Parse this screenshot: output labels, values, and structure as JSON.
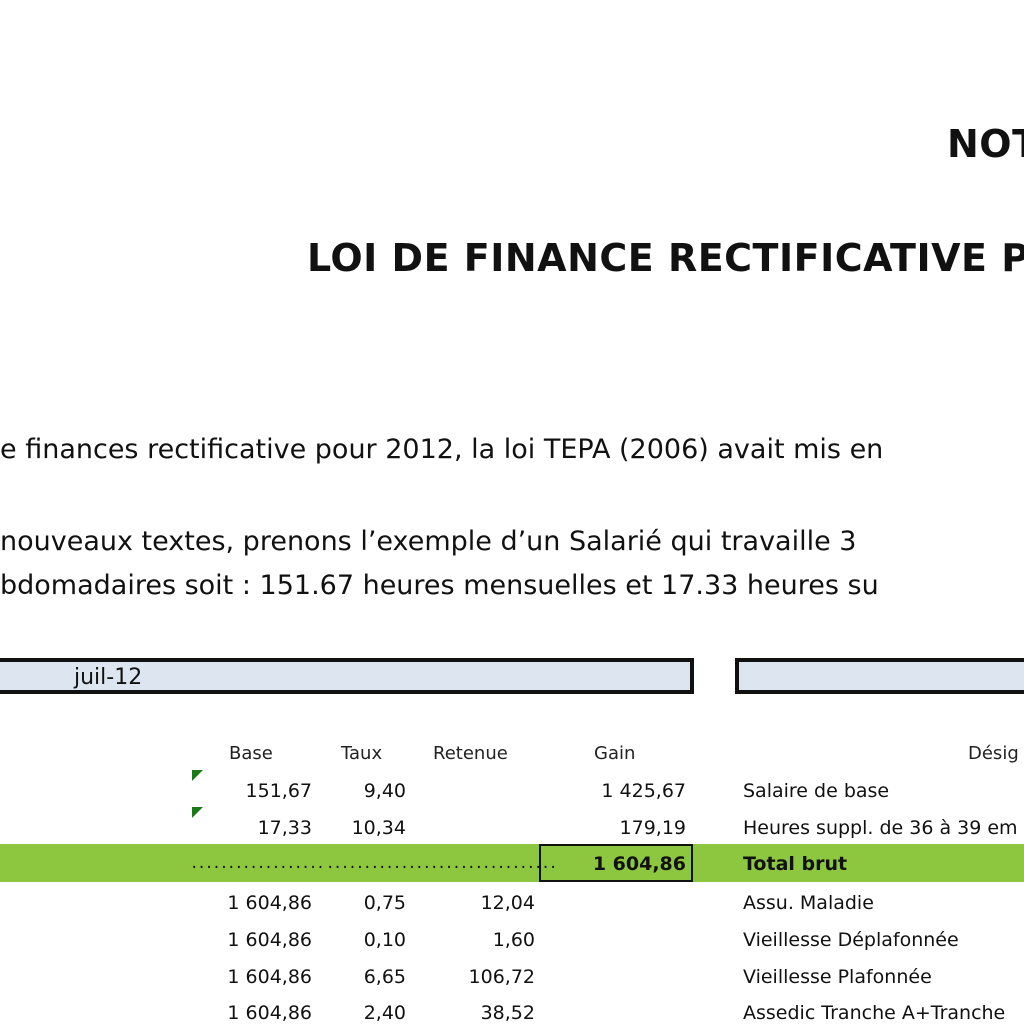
{
  "header": {
    "title_top": "NOT",
    "title_main": "LOI DE FINANCE RECTIFICATIVE PO"
  },
  "intro": {
    "line1": "e finances rectificative pour 2012, la loi TEPA (2006) avait mis en",
    "line2": " nouveaux textes, prenons l’exemple d’un Salarié qui travaille 3",
    "line3": "bdomadaires soit : 151.67 heures mensuelles et 17.33 heures su"
  },
  "period": {
    "label": "juil-12"
  },
  "table": {
    "headers": {
      "base": "Base",
      "taux": "Taux",
      "retenue": "Retenue",
      "gain": "Gain",
      "designation": "Désig"
    },
    "rows": [
      {
        "base": "151,67",
        "taux": "9,40",
        "retenue": "",
        "gain": "1 425,67",
        "designation": "Salaire de base",
        "flag": true
      },
      {
        "base": "17,33",
        "taux": "10,34",
        "retenue": "",
        "gain": "179,19",
        "designation": "Heures suppl. de 36 à 39 em",
        "flag": true
      },
      {
        "base": "1 604,86",
        "taux": "0,75",
        "retenue": "12,04",
        "gain": "",
        "designation": "Assu. Maladie",
        "flag": false
      },
      {
        "base": "1 604,86",
        "taux": "0,10",
        "retenue": "1,60",
        "gain": "",
        "designation": "Vieillesse Déplafonnée",
        "flag": false
      },
      {
        "base": "1 604,86",
        "taux": "6,65",
        "retenue": "106,72",
        "gain": "",
        "designation": "Vieillesse Plafonnée",
        "flag": false
      },
      {
        "base": "1 604,86",
        "taux": "2,40",
        "retenue": "38,52",
        "gain": "",
        "designation": "Assedic Tranche A+Tranche",
        "flag": false
      }
    ],
    "total": {
      "dots1": "..................",
      "dots2": "...............................",
      "gain": "1 604,86",
      "designation": "Total brut"
    }
  },
  "colors": {
    "band": "#8dc63f",
    "bar": "#dde6f0",
    "flag": "#1a7a1a"
  }
}
